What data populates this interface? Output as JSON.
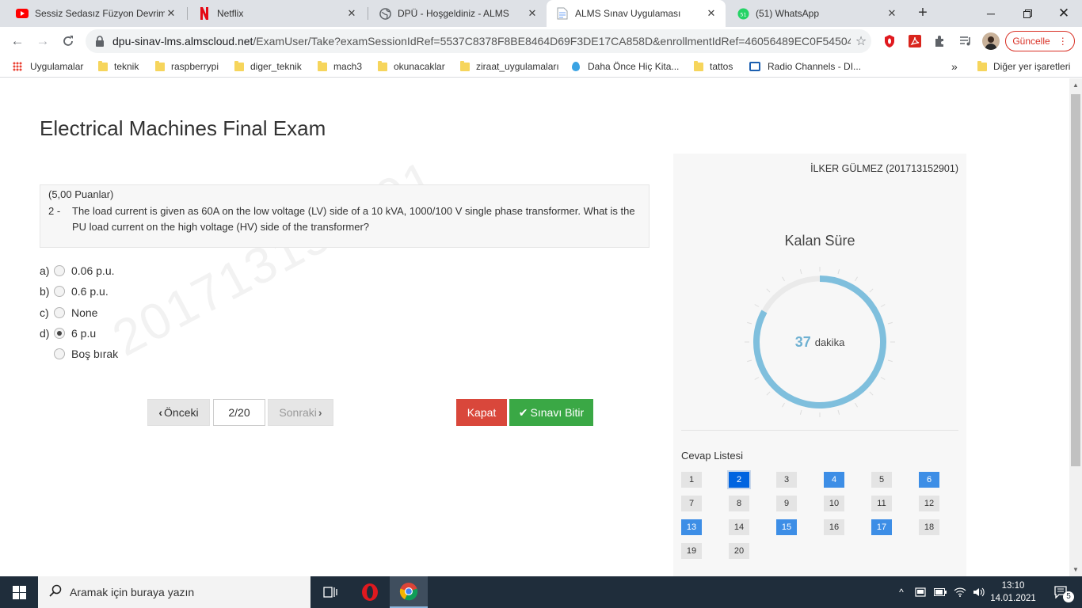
{
  "browser": {
    "tabs": [
      {
        "title": "Sessiz Sedasız Füzyon Devrimi",
        "icon": "youtube-icon"
      },
      {
        "title": "Netflix",
        "icon": "netflix-icon"
      },
      {
        "title": "DPÜ - Hoşgeldiniz - ALMS",
        "icon": "globe-icon"
      },
      {
        "title": "ALMS Sınav Uygulaması",
        "icon": "document-icon"
      },
      {
        "title": "(51) WhatsApp",
        "icon": "whatsapp-icon"
      }
    ],
    "url_host": "dpu-sinav-lms.almscloud.net",
    "url_path": "/ExamUser/Take?examSessionIdRef=5537C8378F8BE8464D69F3DE17CA858D&enrollmentIdRef=46056489EC0F54504F...",
    "update_label": "Güncelle",
    "bookmarks": [
      "Uygulamalar",
      "teknik",
      "raspberrypi",
      "diger_teknik",
      "mach3",
      "okunacaklar",
      "ziraat_uygulamaları",
      "Daha Önce Hiç Kita...",
      "tattos",
      "Radio Channels - DI..."
    ],
    "bookmarks_overflow": "»",
    "other_bookmarks": "Diğer yer işaretleri"
  },
  "exam": {
    "title": "Electrical Machines Final Exam",
    "watermark": "201713152901",
    "question": {
      "points": "(5,00 Puanlar)",
      "number": "2 -",
      "text": "The load current is given as 60A on the low voltage (LV) side of a 10 kVA, 1000/100 V single phase transformer. What is the PU load current on the high voltage (HV) side of the transformer?"
    },
    "options": [
      {
        "letter": "a)",
        "text": "0.06 p.u.",
        "checked": false
      },
      {
        "letter": "b)",
        "text": "0.6 p.u.",
        "checked": false
      },
      {
        "letter": "c)",
        "text": "None",
        "checked": false
      },
      {
        "letter": "d)",
        "text": "6 p.u",
        "checked": true
      },
      {
        "letter": "",
        "text": "Boş bırak",
        "checked": false
      }
    ],
    "nav": {
      "prev": "Önceki",
      "page": "2/20",
      "next": "Sonraki",
      "close": "Kapat",
      "finish": "Sınavı Bitir"
    }
  },
  "sidebar": {
    "student": "İLKER GÜLMEZ (201713152901)",
    "timer_label": "Kalan Süre",
    "timer_value": "37",
    "timer_unit": "dakika",
    "timer_remaining_fraction": 0.83,
    "answers_label": "Cevap Listesi",
    "questions": [
      {
        "n": "1",
        "state": "empty"
      },
      {
        "n": "2",
        "state": "current"
      },
      {
        "n": "3",
        "state": "empty"
      },
      {
        "n": "4",
        "state": "answered"
      },
      {
        "n": "5",
        "state": "empty"
      },
      {
        "n": "6",
        "state": "answered"
      },
      {
        "n": "7",
        "state": "empty"
      },
      {
        "n": "8",
        "state": "empty"
      },
      {
        "n": "9",
        "state": "empty"
      },
      {
        "n": "10",
        "state": "empty"
      },
      {
        "n": "11",
        "state": "empty"
      },
      {
        "n": "12",
        "state": "empty"
      },
      {
        "n": "13",
        "state": "answered"
      },
      {
        "n": "14",
        "state": "empty"
      },
      {
        "n": "15",
        "state": "answered"
      },
      {
        "n": "16",
        "state": "empty"
      },
      {
        "n": "17",
        "state": "answered"
      },
      {
        "n": "18",
        "state": "empty"
      },
      {
        "n": "19",
        "state": "empty"
      },
      {
        "n": "20",
        "state": "empty"
      }
    ],
    "colors": {
      "timer_arc": "#7fbfdd",
      "answered": "#3d8ee6",
      "current": "#0064e0",
      "close_button": "#d9473b",
      "finish_button": "#3aa845"
    }
  },
  "taskbar": {
    "search_placeholder": "Aramak için buraya yazın",
    "time": "13:10",
    "date": "14.01.2021",
    "notifications": "5"
  }
}
